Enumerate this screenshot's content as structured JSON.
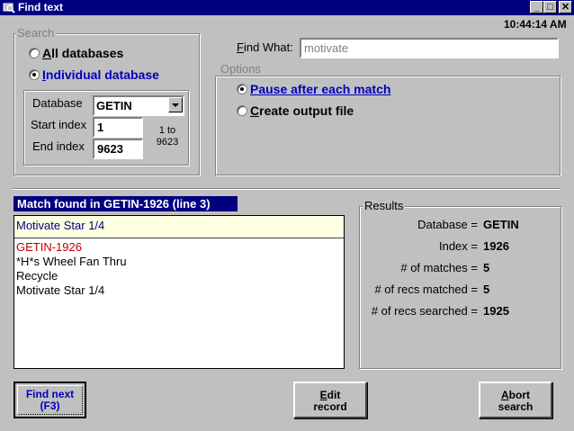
{
  "window": {
    "title": "Find text",
    "clock": "10:44:14 AM"
  },
  "search": {
    "legend": "Search",
    "all_databases": "All databases",
    "all_databases_key": "A",
    "all_databases_rest": "ll databases",
    "individual": "Individual database",
    "individual_key": "I",
    "individual_rest": "ndividual database",
    "database_label": "Database",
    "database_value": "GETIN",
    "start_label": "Start index",
    "start_value": "1",
    "end_label": "End index",
    "end_value": "9623",
    "range_line1": "1 to",
    "range_line2": "9623"
  },
  "find_what": {
    "label": "Find What:",
    "value": "motivate"
  },
  "options": {
    "legend": "Options",
    "pause": "Pause after each match",
    "create": "Create output file"
  },
  "match": {
    "header": "Match found in GETIN-1926  (line 3)",
    "highlight": "Motivate Star 1/4",
    "lines": [
      "GETIN-1926",
      "*H*s Wheel Fan Thru",
      "Recycle",
      "Motivate Star 1/4"
    ]
  },
  "results": {
    "legend": "Results",
    "rows": [
      {
        "label": "Database =",
        "value": "GETIN"
      },
      {
        "label": "Index =",
        "value": "1926"
      },
      {
        "label": "# of matches =",
        "value": "5"
      },
      {
        "label": "# of recs matched =",
        "value": "5"
      },
      {
        "label": "# of recs searched =",
        "value": "1925"
      }
    ]
  },
  "buttons": {
    "find_next_line1": "Find next",
    "find_next_line2": "(F3)",
    "edit_line1": "Edit",
    "edit_line2": "record",
    "abort_line1": "Abort",
    "abort_line2": "search"
  },
  "colors": {
    "title_bar": "#000080",
    "face": "#c0c0c0",
    "accent_blue": "#0000c0",
    "record_red": "#c00000",
    "highlight_bg": "#ffffe1"
  }
}
